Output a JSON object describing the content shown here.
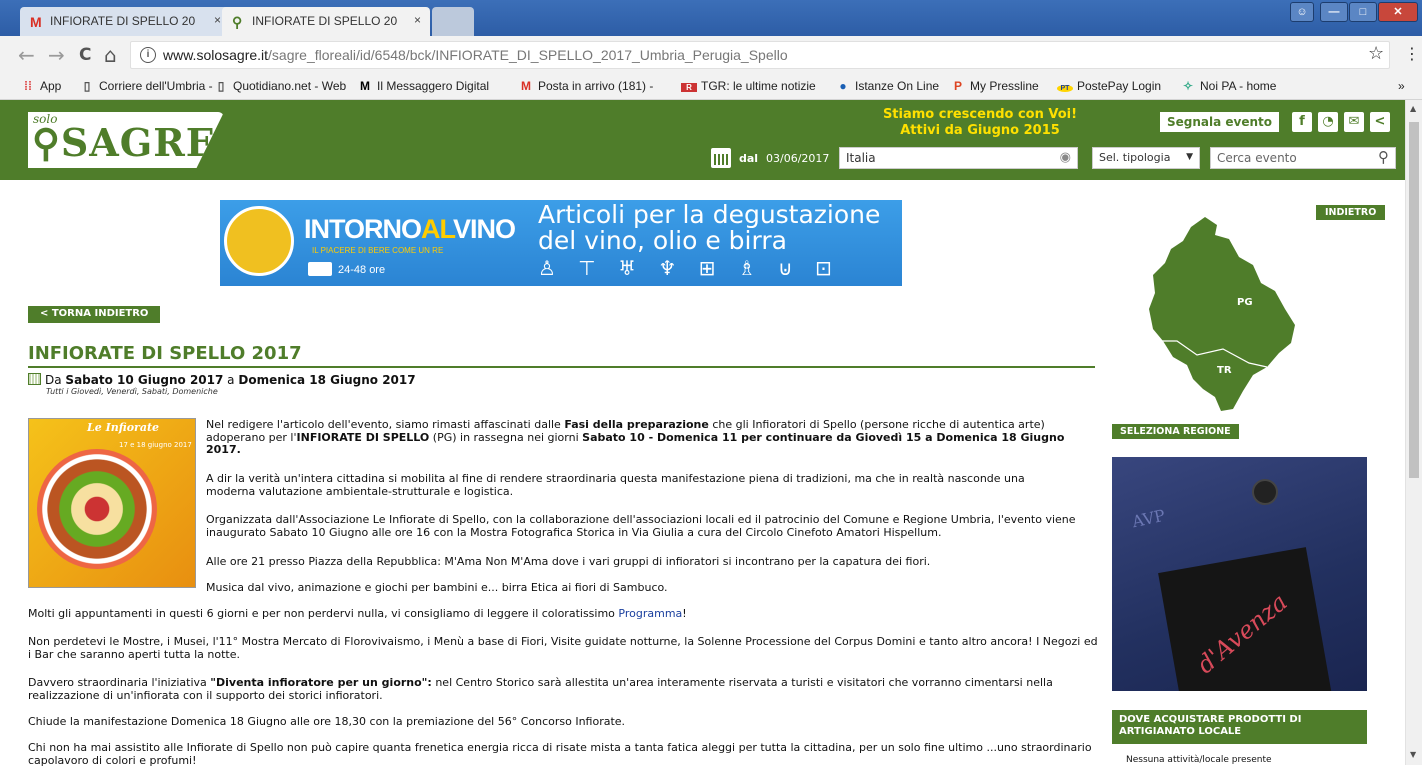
{
  "browser": {
    "tabs": [
      {
        "title": "INFIORATE DI SPELLO 20",
        "icon": "gmail-icon",
        "icon_glyph": "M",
        "icon_color": "#d93025"
      },
      {
        "title": "INFIORATE DI SPELLO 20",
        "icon": "sagre-favicon",
        "icon_glyph": "⚲",
        "icon_color": "#4f7d2a"
      }
    ],
    "tab_close": "×",
    "url_host": "www.solosagre.it",
    "url_path": "/sagre_floreali/id/6548/bck/INFIORATE_DI_SPELLO_2017_Umbria_Perugia_Spello",
    "star": "☆",
    "menu": "⋮",
    "nav": {
      "back": "←",
      "forward": "→",
      "reload": "C",
      "home": "⌂"
    },
    "window_controls": {
      "minimize": "—",
      "maximize": "□",
      "close": "✕",
      "user": "☺"
    },
    "bookmarks": [
      {
        "label": "App",
        "icon": "apps-grid-icon",
        "glyph": "⁞⁞",
        "color": "#d44"
      },
      {
        "label": "Corriere dell'Umbria -",
        "icon": "page-icon",
        "glyph": "▯",
        "color": "#555"
      },
      {
        "label": "Quotidiano.net - Web",
        "icon": "page-icon",
        "glyph": "▯",
        "color": "#555"
      },
      {
        "label": "Il Messaggero Digital",
        "icon": "messaggero-icon",
        "glyph": "M",
        "color": "#000"
      },
      {
        "label": "Posta in arrivo (181) -",
        "icon": "gmail-icon",
        "glyph": "M",
        "color": "#d93025"
      },
      {
        "label": "TGR: le ultime notizie",
        "icon": "rai-icon",
        "glyph": "R",
        "color": "#c33"
      },
      {
        "label": "Istanze On Line",
        "icon": "istanze-icon",
        "glyph": "●",
        "color": "#1a5fb4"
      },
      {
        "label": "My Pressline",
        "icon": "pressline-icon",
        "glyph": "P",
        "color": "#d42"
      },
      {
        "label": "PostePay Login",
        "icon": "postepay-icon",
        "glyph": "PT",
        "color": "#c9a800"
      },
      {
        "label": "Noi PA - home",
        "icon": "noipa-icon",
        "glyph": "✧",
        "color": "#3a8"
      }
    ],
    "bookmarks_more": "»"
  },
  "site": {
    "logo_small": "solo",
    "logo_main": "⚲SAGRE",
    "promo_line1": "Stiamo crescendo con Voi!",
    "promo_line2": "Attivi da Giugno 2015",
    "segnala": "Segnala evento",
    "social": [
      {
        "icon": "facebook-icon",
        "glyph": "f"
      },
      {
        "icon": "rss-icon",
        "glyph": "◔"
      },
      {
        "icon": "mail-icon",
        "glyph": "✉"
      },
      {
        "icon": "share-icon",
        "glyph": "<"
      }
    ],
    "dal": "dal",
    "date": "03/06/2017",
    "location_value": "Italia",
    "tipologia": "Sel. tipologia",
    "search_placeholder": "Cerca evento",
    "colors": {
      "green": "#4f7d2a",
      "yellow": "#ffe000"
    }
  },
  "banner": {
    "brand_a": "INTORNO",
    "brand_b": "AL",
    "brand_c": "VINO",
    "tagline": "IL PIACERE DI BERE COME UN RE",
    "delivery": "24-48 ore",
    "headline_1": "Articoli per la degustazione",
    "headline_2": "del vino, olio e birra",
    "glyphs": "♙ ⊤ ♅ ♆ ⊞ ♗ ⊍ ⊡"
  },
  "event": {
    "back": "< TORNA INDIETRO",
    "title": "INFIORATE DI SPELLO 2017",
    "date_prefix": "Da",
    "date_from": "Sabato 10 Giugno 2017",
    "date_mid": "a",
    "date_to": "Domenica 18 Giugno 2017",
    "days": "Tutti i Giovedì, Venerdì, Sabati, Domeniche",
    "poster_title": "Le Infiorate",
    "poster_sub": "17 e 18 giugno 2017",
    "p1a": "Nel redigere l'articolo dell'evento, siamo rimasti affascinati dalle ",
    "p1link": "Fasi della preparazione",
    "p1b": " che gli Infioratori di Spello (persone ricche di autentica arte) adoperano per l'",
    "p1c": "INFIORATE DI SPELLO",
    "p1d": " (PG) in rassegna nei giorni ",
    "p1e": "Sabato 10 - Domenica 11 per continuare da Giovedì 15 a Domenica 18 Giugno 2017.",
    "p2": "A dir la verità un'intera cittadina si mobilita al fine di rendere straordinaria questa manifestazione piena di tradizioni, ma che in realtà nasconde una moderna valutazione ambientale-strutturale e logistica.",
    "p3": "Organizzata dall'Associazione Le Infiorate di Spello, con la collaborazione dell'associazioni locali ed il patrocinio del Comune e Regione Umbria, l'evento viene inaugurato Sabato 10 Giugno alle ore 16 con la Mostra Fotografica Storica in Via Giulia a cura del Circolo Cinefoto Amatori Hispellum.",
    "p4": "Alle ore 21 presso Piazza della Repubblica: M'Ama Non M'Ama dove i vari gruppi di infioratori si incontrano per la capatura dei fiori.",
    "p5": "Musica dal vivo, animazione e giochi per bambini e... birra Etica ai fiori di Sambuco.",
    "p6a": "Molti gli appuntamenti in questi 6 giorni e per non perdervi nulla, vi consigliamo di leggere il coloratissimo ",
    "p6link": "Programma",
    "p6b": "!",
    "p7": "Non perdetevi le Mostre, i Musei, l'11° Mostra Mercato di Florovivaismo, i Menù a base di Fiori, Visite guidate notturne, la Solenne Processione del Corpus Domini e tanto altro ancora! I Negozi ed i Bar che saranno aperti tutta la notte.",
    "p8a": "Davvero straordinaria l'iniziativa ",
    "p8b": "\"Diventa infioratore per un giorno\":",
    "p8c": " nel Centro Storico sarà allestita un'area interamente riservata a turisti e visitatori che vorranno cimentarsi nella realizzazione di un'infiorata con il supporto dei storici infioratori.",
    "p9": "Chiude la manifestazione Domenica 18 Giugno alle ore 18,30 con la premiazione del 56° Concorso Infiorate.",
    "p10": "Chi non ha mai assistito alle Infiorate di Spello non può capire quanta frenetica energia ricca di risate mista a tanta fatica aleggi per tutta la cittadina, per un solo fine ultimo ...uno straordinario capolavoro di colori e profumi!"
  },
  "sidebar": {
    "indietro": "INDIETRO",
    "map_pg": "PG",
    "map_tr": "TR",
    "seleziona": "SELEZIONA REGIONE",
    "ad_brand": "d'Avenza",
    "ad_stitch": "AVP",
    "dove": "DOVE ACQUISTARE PRODOTTI DI ARTIGIANATO LOCALE",
    "nessuna": "Nessuna attività/locale presente"
  }
}
